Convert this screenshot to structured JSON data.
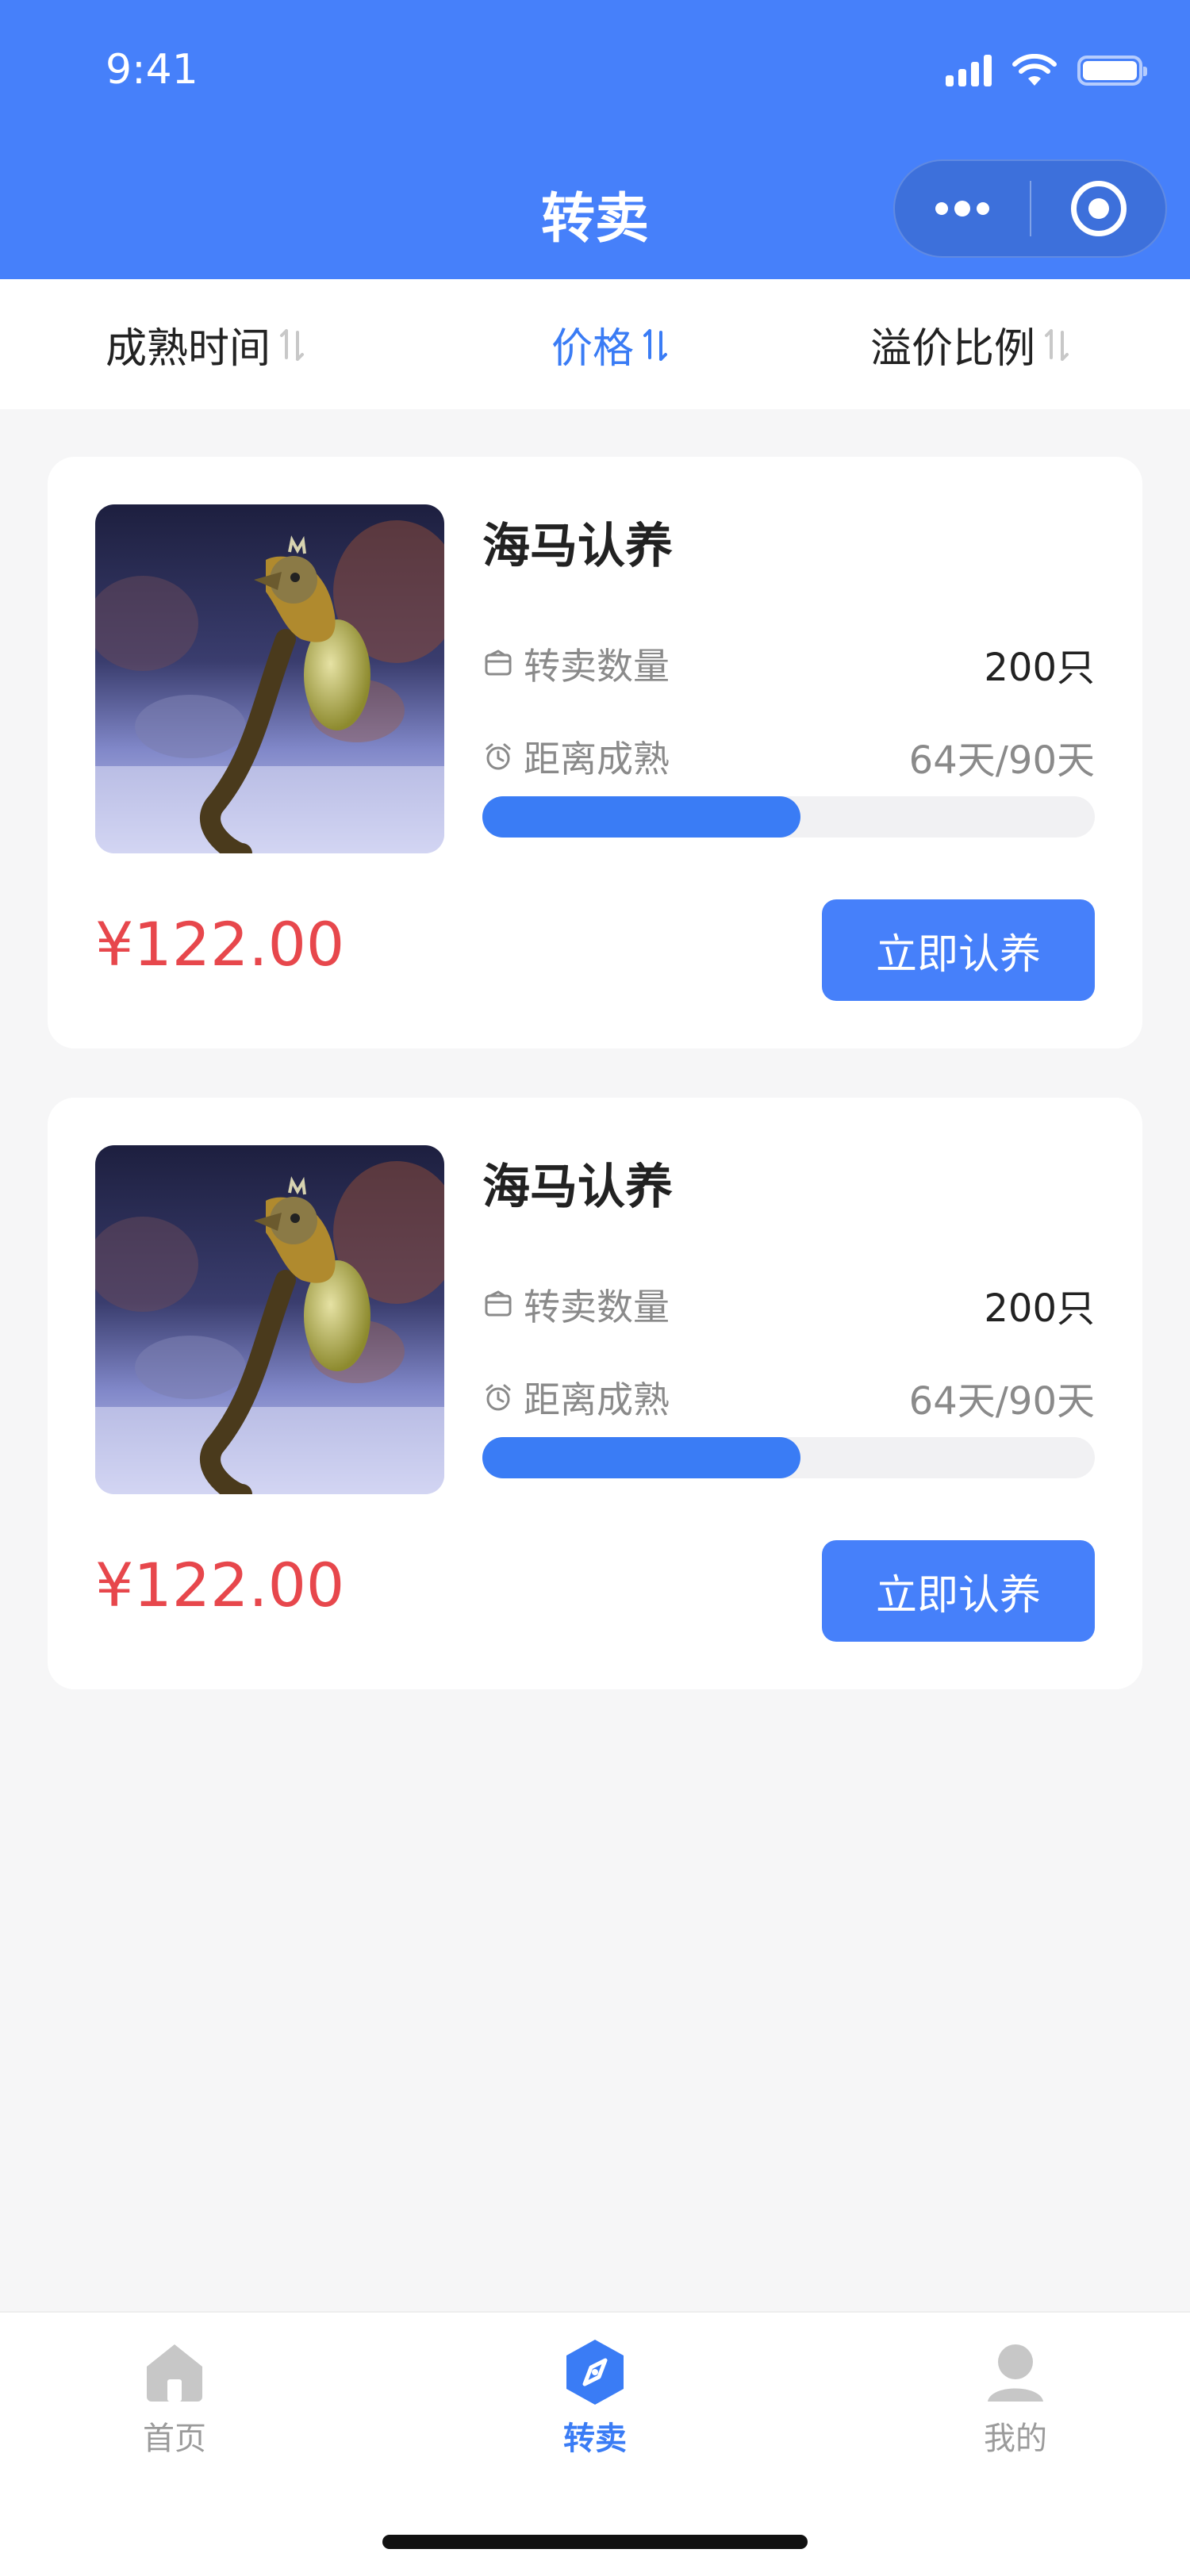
{
  "status_bar": {
    "time": "9:41"
  },
  "nav": {
    "title": "转卖"
  },
  "sort_bar": {
    "items": [
      {
        "label": "成熟时间",
        "active": false
      },
      {
        "label": "价格",
        "active": true
      },
      {
        "label": "溢价比例",
        "active": false
      }
    ]
  },
  "listings": [
    {
      "title": "海马认养",
      "quantity_label": "转卖数量",
      "quantity_value": "200只",
      "maturity_label": "距离成熟",
      "maturity_value": "64天/90天",
      "progress_fraction": 0.52,
      "price": "¥122.00",
      "button_label": "立即认养"
    },
    {
      "title": "海马认养",
      "quantity_label": "转卖数量",
      "quantity_value": "200只",
      "maturity_label": "距离成熟",
      "maturity_value": "64天/90天",
      "progress_fraction": 0.52,
      "price": "¥122.00",
      "button_label": "立即认养"
    }
  ],
  "tabbar": {
    "items": [
      {
        "label": "首页",
        "icon": "home-icon",
        "active": false
      },
      {
        "label": "转卖",
        "icon": "compass-icon",
        "active": true
      },
      {
        "label": "我的",
        "icon": "user-icon",
        "active": false
      }
    ]
  },
  "colors": {
    "brand": "#4680fa",
    "price": "#e7474c",
    "active": "#3a7cf5"
  }
}
